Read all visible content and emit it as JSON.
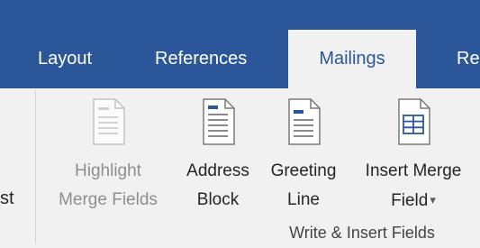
{
  "tabs": [
    {
      "label": "Layout",
      "active": false
    },
    {
      "label": "References",
      "active": false
    },
    {
      "label": "Mailings",
      "active": true
    },
    {
      "label": "Rev",
      "active": false
    }
  ],
  "colors": {
    "tab_bar_bg": "#2b579a",
    "ribbon_bg": "#f1f1f1",
    "icon_accent": "#2b579a"
  },
  "ribbon": {
    "cut_off_label": "st",
    "commands": [
      {
        "line1": "Highlight",
        "line2": "Merge Fields",
        "icon": "highlight-merge-fields-icon",
        "enabled": false
      },
      {
        "line1": "Address",
        "line2": "Block",
        "icon": "address-block-icon",
        "enabled": true
      },
      {
        "line1": "Greeting",
        "line2": "Line",
        "icon": "greeting-line-icon",
        "enabled": true
      },
      {
        "line1": "Insert Merge",
        "line2": "Field",
        "icon": "insert-merge-field-icon",
        "enabled": true,
        "has_dropdown": true,
        "dropdown_glyph": "▾"
      }
    ],
    "group_label": "Write & Insert Fields"
  }
}
